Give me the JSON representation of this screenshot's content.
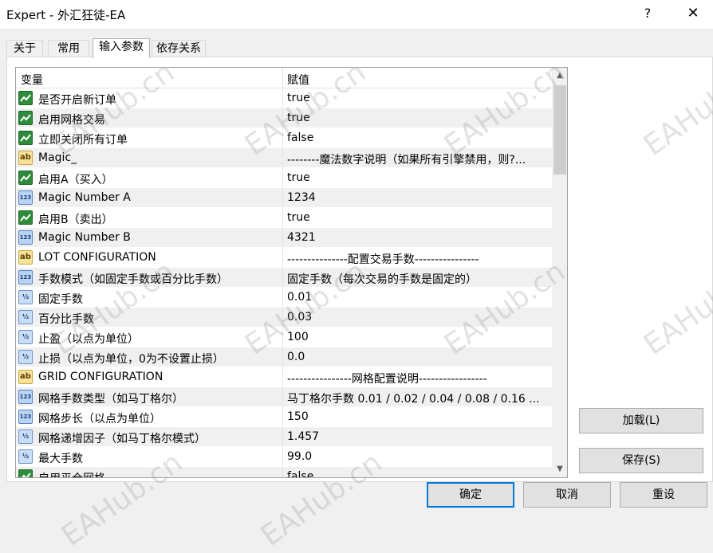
{
  "window": {
    "title": "Expert - 外汇狂徒-EA",
    "help_label": "?",
    "close_label": "✕"
  },
  "tabs": [
    {
      "label": "关于"
    },
    {
      "label": "常用"
    },
    {
      "label": "输入参数"
    },
    {
      "label": "依存关系"
    }
  ],
  "grid": {
    "col_variable": "变量",
    "col_value": "赋值",
    "rows": [
      {
        "type": "bool",
        "name": "是否开启新订单",
        "value": "true"
      },
      {
        "type": "bool",
        "name": "启用网格交易",
        "value": "true"
      },
      {
        "type": "bool",
        "name": "立即关闭所有订单",
        "value": "false"
      },
      {
        "type": "string",
        "name": "Magic_",
        "value": "--------魔法数字说明（如果所有引擎禁用，则?..."
      },
      {
        "type": "bool",
        "name": "启用A（买入）",
        "value": "true"
      },
      {
        "type": "int",
        "name": "Magic Number  A",
        "value": "1234"
      },
      {
        "type": "bool",
        "name": "启用B（卖出）",
        "value": "true"
      },
      {
        "type": "int",
        "name": "Magic Number  B",
        "value": "4321"
      },
      {
        "type": "string",
        "name": "LOT CONFIGURATION",
        "value": "---------------配置交易手数----------------"
      },
      {
        "type": "int",
        "name": "手数模式（如固定手数或百分比手数）",
        "value": "固定手数（每次交易的手数是固定的）"
      },
      {
        "type": "double",
        "name": "固定手数",
        "value": "0.01"
      },
      {
        "type": "double",
        "name": "百分比手数",
        "value": "0.03"
      },
      {
        "type": "double",
        "name": "止盈（以点为单位）",
        "value": "100"
      },
      {
        "type": "double",
        "name": "止损（以点为单位，0为不设置止损）",
        "value": "0.0"
      },
      {
        "type": "string",
        "name": "GRID CONFIGURATION",
        "value": "----------------网格配置说明-----------------"
      },
      {
        "type": "int",
        "name": "网格手数类型（如马丁格尔）",
        "value": "马丁格尔手数  0.01 / 0.02 / 0.04 / 0.08 / 0.16 ..."
      },
      {
        "type": "int",
        "name": "网格步长（以点为单位）",
        "value": "150"
      },
      {
        "type": "double",
        "name": "网格递增因子（如马丁格尔模式）",
        "value": "1.457"
      },
      {
        "type": "double",
        "name": "最大手数",
        "value": "99.0"
      },
      {
        "type": "bool",
        "name": "启用平仓网格",
        "value": "false"
      }
    ]
  },
  "buttons": {
    "load": "加载(L)",
    "save": "保存(S)",
    "ok": "确定",
    "cancel": "取消",
    "reset": "重设"
  },
  "icons": {
    "bool": "bool-toggle-icon",
    "string": "ab-string-icon",
    "int": "number-123-icon",
    "double": "fraction-half-icon"
  },
  "watermark": "EAHub.cn",
  "colors": {
    "primary_border": "#0078d7",
    "row_alt": "#f0f0f0"
  }
}
